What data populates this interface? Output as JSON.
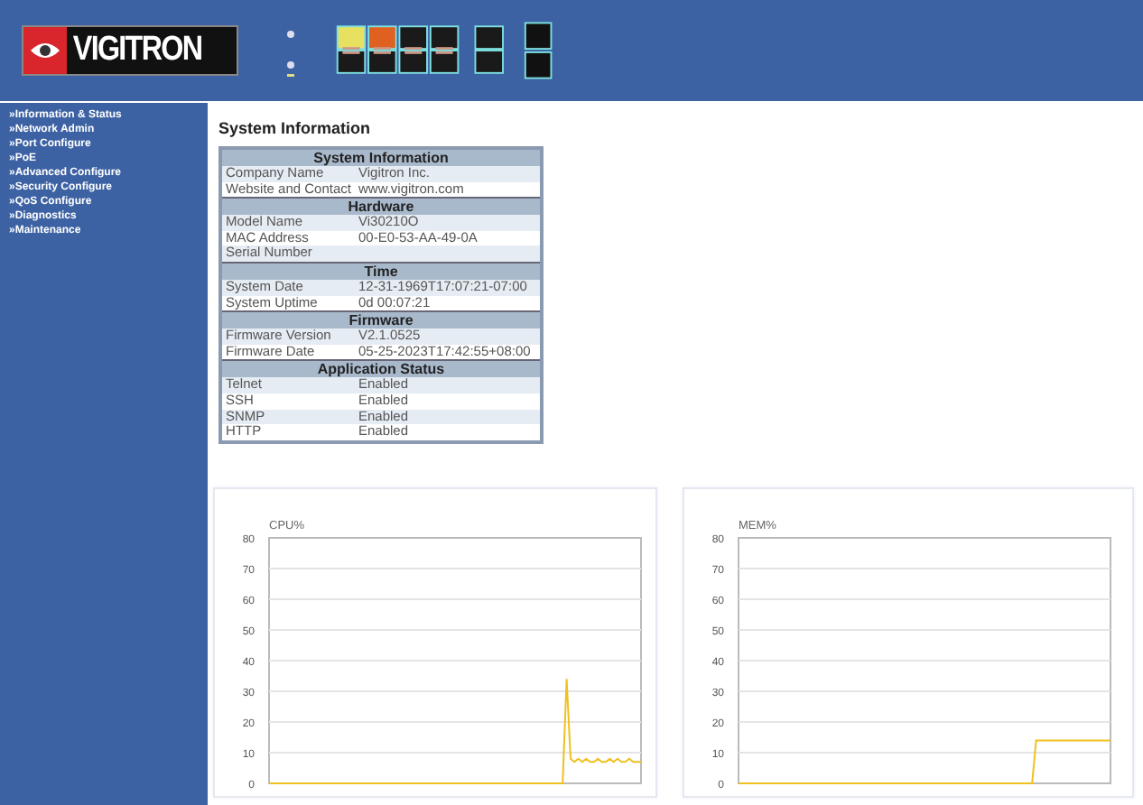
{
  "header": {
    "logo": "VIGITRON"
  },
  "sidebar": {
    "items": [
      {
        "label": "»Information & Status"
      },
      {
        "label": "»Network Admin"
      },
      {
        "label": "»Port Configure"
      },
      {
        "label": "»PoE"
      },
      {
        "label": "»Advanced Configure"
      },
      {
        "label": "»Security Configure"
      },
      {
        "label": "»QoS Configure"
      },
      {
        "label": "»Diagnostics"
      },
      {
        "label": "»Maintenance"
      }
    ]
  },
  "page_title": "System Information",
  "sections": [
    {
      "title": "System Information",
      "rows": [
        [
          "Company Name",
          "Vigitron Inc."
        ],
        [
          "Website and Contact",
          "www.vigitron.com"
        ]
      ]
    },
    {
      "title": "Hardware",
      "rows": [
        [
          "Model Name",
          "Vi30210O"
        ],
        [
          "MAC Address",
          "00-E0-53-AA-49-0A"
        ],
        [
          "Serial Number",
          ""
        ]
      ]
    },
    {
      "title": "Time",
      "rows": [
        [
          "System Date",
          "12-31-1969T17:07:21-07:00"
        ],
        [
          "System Uptime",
          "0d 00:07:21"
        ]
      ]
    },
    {
      "title": "Firmware",
      "rows": [
        [
          "Firmware Version",
          "V2.1.0525"
        ],
        [
          "Firmware Date",
          "05-25-2023T17:42:55+08:00"
        ]
      ]
    },
    {
      "title": "Application Status",
      "rows": [
        [
          "Telnet",
          "Enabled"
        ],
        [
          "SSH",
          "Enabled"
        ],
        [
          "SNMP",
          "Enabled"
        ],
        [
          "HTTP",
          "Enabled"
        ]
      ]
    }
  ],
  "charts": [
    {
      "chart_data": {
        "type": "line",
        "title": "CPU%",
        "grid": true,
        "ylim": [
          0,
          80
        ],
        "yticks": [
          0,
          10,
          20,
          30,
          40,
          50,
          60,
          70,
          80
        ],
        "series": [
          {
            "color": "#f0c020",
            "values": [
              0,
              0,
              0,
              0,
              0,
              0,
              0,
              0,
              0,
              0,
              0,
              0,
              0,
              0,
              0,
              0,
              0,
              0,
              0,
              0,
              0,
              0,
              0,
              0,
              0,
              0,
              0,
              0,
              0,
              0,
              0,
              0,
              0,
              0,
              0,
              0,
              0,
              0,
              0,
              0,
              0,
              0,
              0,
              0,
              0,
              0,
              0,
              0,
              0,
              0,
              0,
              0,
              0,
              0,
              0,
              0,
              0,
              0,
              0,
              0,
              0,
              0,
              0,
              0,
              0,
              0,
              0,
              0,
              0,
              0,
              0,
              0,
              0,
              0,
              0,
              0,
              34,
              8,
              7,
              8,
              7,
              8,
              7,
              7,
              8,
              7,
              7,
              8,
              7,
              8,
              7,
              7,
              8,
              7,
              7,
              7
            ]
          }
        ]
      }
    },
    {
      "chart_data": {
        "type": "line",
        "title": "MEM%",
        "grid": true,
        "ylim": [
          0,
          80
        ],
        "yticks": [
          0,
          10,
          20,
          30,
          40,
          50,
          60,
          70,
          80
        ],
        "series": [
          {
            "color": "#f0c020",
            "values": [
              0,
              0,
              0,
              0,
              0,
              0,
              0,
              0,
              0,
              0,
              0,
              0,
              0,
              0,
              0,
              0,
              0,
              0,
              0,
              0,
              0,
              0,
              0,
              0,
              0,
              0,
              0,
              0,
              0,
              0,
              0,
              0,
              0,
              0,
              0,
              0,
              0,
              0,
              0,
              0,
              0,
              0,
              0,
              0,
              0,
              0,
              0,
              0,
              0,
              0,
              0,
              0,
              0,
              0,
              0,
              0,
              0,
              0,
              0,
              0,
              0,
              0,
              0,
              0,
              0,
              0,
              0,
              0,
              0,
              0,
              0,
              0,
              0,
              0,
              0,
              0,
              14,
              14,
              14,
              14,
              14,
              14,
              14,
              14,
              14,
              14,
              14,
              14,
              14,
              14,
              14,
              14,
              14,
              14,
              14,
              14
            ]
          }
        ]
      }
    }
  ]
}
